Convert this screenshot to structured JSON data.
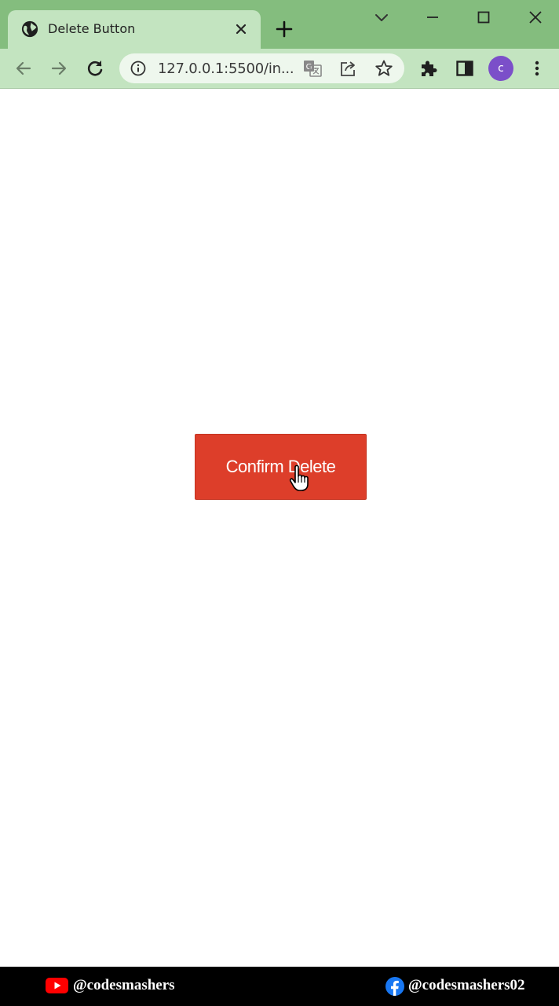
{
  "browser": {
    "tab": {
      "title": "Delete Button"
    },
    "address_bar": {
      "url": "127.0.0.1:5500/in..."
    },
    "profile": {
      "initial": "c",
      "color": "#7b4fc9"
    },
    "chrome_color": "#84bd7e",
    "toolbar_color": "#c3e4c0"
  },
  "icons": {
    "favicon": "globe-icon",
    "tab_close": "close-icon",
    "new_tab": "plus-icon",
    "tab_search": "chevron-down-icon",
    "minimize": "minimize-icon",
    "maximize": "maximize-icon",
    "close_window": "close-icon",
    "back": "back-arrow-icon",
    "forward": "forward-arrow-icon",
    "reload": "reload-icon",
    "site_info": "info-icon",
    "translate": "translate-icon",
    "share": "share-icon",
    "bookmark": "star-icon",
    "extensions": "puzzle-icon",
    "side_panel": "side-panel-icon",
    "menu": "kebab-menu-icon",
    "cursor": "hand-pointer-icon"
  },
  "page": {
    "confirm_button": {
      "label": "Confirm Delete",
      "color": "#dd3e2a"
    }
  },
  "footer": {
    "youtube_handle": "@codesmashers",
    "facebook_handle": "@codesmashers02"
  }
}
